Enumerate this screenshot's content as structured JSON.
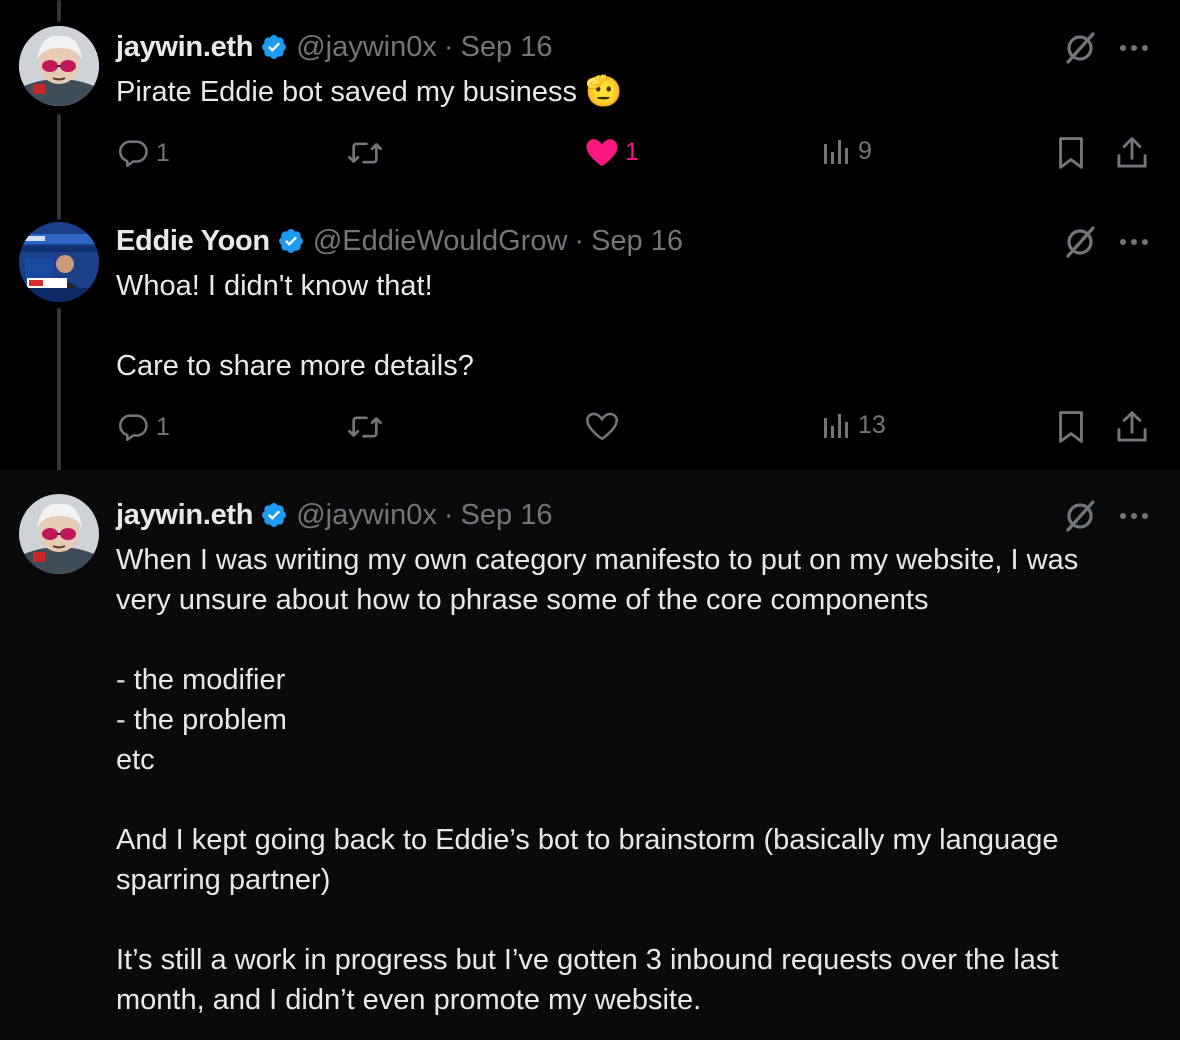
{
  "tweets": [
    {
      "author": "jaywin.eth",
      "handle": "@jaywin0x",
      "date": "Sep 16",
      "text": "Pirate Eddie bot saved my business",
      "emoji": "🫡",
      "replies": "1",
      "retweets": "",
      "likes": "1",
      "liked": true,
      "views": "9"
    },
    {
      "author": "Eddie Yoon",
      "handle": "@EddieWouldGrow",
      "date": "Sep 16",
      "text": "Whoa! I didn't know that!\n\nCare to share more details?",
      "replies": "1",
      "retweets": "",
      "likes": "",
      "liked": false,
      "views": "13"
    },
    {
      "author": "jaywin.eth",
      "handle": "@jaywin0x",
      "date": "Sep 16",
      "text": "When I was writing my own category manifesto to put on my website, I was\nvery unsure about how to phrase some of the core components\n\n- the modifier\n- the problem\netc\n\nAnd I kept going back to Eddie’s bot to brainstorm (basically my language\nsparring partner)\n\nIt’s still a work in progress but I’ve gotten 3 inbound requests over the last\nmonth, and I didn’t even promote my website."
    }
  ],
  "separator": "·",
  "colors": {
    "background": "#000000",
    "highlight_background": "#0a0a0a",
    "text": "#e7e9ea",
    "muted": "#71767b",
    "verified": "#1d9bf0",
    "like": "#f91880",
    "thread_line": "#333639"
  },
  "icons": [
    "verified-badge-icon",
    "grok-icon",
    "more-icon",
    "reply-icon",
    "retweet-icon",
    "heart-icon",
    "views-icon",
    "bookmark-icon",
    "share-icon"
  ]
}
